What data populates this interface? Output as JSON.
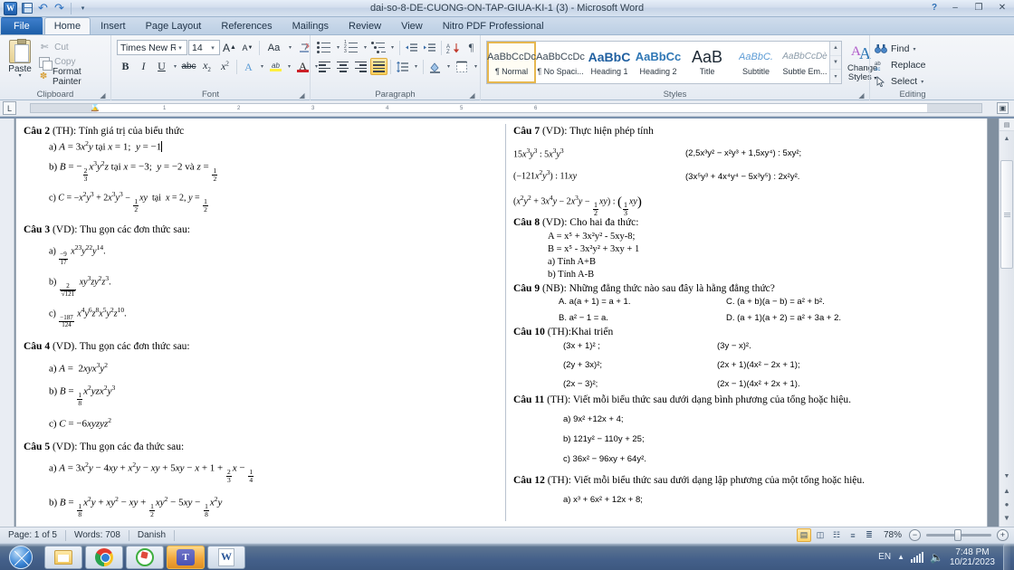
{
  "window": {
    "title": "dai-so-8-DE-CUONG-ON-TAP-GIUA-KI-1 (3)  -  Microsoft Word",
    "minimize": "–",
    "restore": "❐",
    "close": "✕",
    "help": "?"
  },
  "quick_access": {
    "word_letter": "W",
    "save": "save-icon",
    "undo": "↶",
    "redo": "↷",
    "customize": "▾"
  },
  "tabs": [
    {
      "label": "File",
      "id": "file"
    },
    {
      "label": "Home",
      "id": "home"
    },
    {
      "label": "Insert",
      "id": "insert"
    },
    {
      "label": "Page Layout",
      "id": "page-layout"
    },
    {
      "label": "References",
      "id": "references"
    },
    {
      "label": "Mailings",
      "id": "mailings"
    },
    {
      "label": "Review",
      "id": "review"
    },
    {
      "label": "View",
      "id": "view"
    },
    {
      "label": "Nitro PDF Professional",
      "id": "nitro-pdf"
    }
  ],
  "active_tab": "Home",
  "ribbon": {
    "clipboard": {
      "group_label": "Clipboard",
      "paste": "Paste",
      "cut": "Cut",
      "copy": "Copy",
      "format_painter": "Format Painter"
    },
    "font": {
      "group_label": "Font",
      "font_name": "Times New Rom",
      "font_size": "14",
      "grow_font": "A",
      "shrink_font": "A",
      "change_case": "Aa",
      "clear_formatting": "clear-formatting-icon",
      "bold": "B",
      "italic": "I",
      "underline": "U",
      "strikethrough": "abc",
      "subscript": "x",
      "superscript": "x",
      "text_effects": "A",
      "highlight": "ab",
      "font_color": "A"
    },
    "paragraph": {
      "group_label": "Paragraph",
      "bullets": "bullets-icon",
      "numbering": "numbering-icon",
      "multilevel": "multilevel-list-icon",
      "decrease_indent": "decrease-indent-icon",
      "increase_indent": "increase-indent-icon",
      "sort": "sort-icon",
      "show_marks": "¶",
      "align_left": "align-left-icon",
      "align_center": "align-center-icon",
      "align_right": "align-right-icon",
      "justify": "justify-icon",
      "line_spacing": "line-spacing-icon",
      "shading": "shading-icon",
      "borders": "borders-icon"
    },
    "styles": {
      "group_label": "Styles",
      "items": [
        {
          "preview": "AaBbCcDc",
          "name": "¶ Normal",
          "selected": true
        },
        {
          "preview": "AaBbCcDc",
          "name": "¶ No Spaci...",
          "selected": false
        },
        {
          "preview": "AaBbC",
          "name": "Heading 1",
          "selected": false
        },
        {
          "preview": "AaBbCc",
          "name": "Heading 2",
          "selected": false
        },
        {
          "preview": "AaB",
          "name": "Title",
          "selected": false
        },
        {
          "preview": "AaBbC.",
          "name": "Subtitle",
          "selected": false
        },
        {
          "preview": "AaBbCcDè",
          "name": "Subtle Em...",
          "selected": false
        }
      ],
      "change_styles": "Change\nStyles"
    },
    "editing": {
      "group_label": "Editing",
      "find": "Find",
      "replace": "Replace",
      "select": "Select"
    }
  },
  "ruler": {
    "tab_selector": "L",
    "marks": [
      "1",
      "2",
      "3",
      "4",
      "5",
      "6"
    ]
  },
  "document": {
    "left_column": [
      {
        "heading_bold": "Câu 2",
        "heading_rest": " (TH): Tính giá trị của biểu thức",
        "items": [
          {
            "label": "a)",
            "text": "A = 3x²y tại x = 1;  y = −1",
            "caret": true
          },
          {
            "label": "b)",
            "text": "B = −⅔x³y²z tại x = −3;  y = −2 và z = ½"
          },
          {
            "label": "c)",
            "text": "C = −x²y³ + 2x³y³ − ½xy  tại  x = 2, y = ½"
          }
        ]
      },
      {
        "heading_bold": "Câu 3",
        "heading_rest": " (VD): Thu gọn các đơn thức sau:",
        "items": [
          {
            "label": "a)",
            "text": "(−9/17) x²³y²²y¹⁴."
          },
          {
            "label": "b)",
            "text": "(2/√121) xy³zy²z³."
          },
          {
            "label": "c)",
            "text": "(−187/124) x⁴y⁶z⁸x⁵y²z¹⁰."
          }
        ]
      },
      {
        "heading_bold": "Câu 4",
        "heading_rest": " (VD). Thu gọn các đơn thức sau:",
        "items": [
          {
            "label": "a)",
            "text": "A =  2xyx³y²"
          },
          {
            "label": "b)",
            "text": "B = ⅛x²yzx²y³"
          },
          {
            "label": "c)",
            "text": "C = −6xyzyz²"
          }
        ]
      },
      {
        "heading_bold": "Câu 5",
        "heading_rest": " (VD): Thu gọn các đa thức sau:",
        "items": [
          {
            "label": "a)",
            "text": "A = 3x²y − 4xy + x²y − xy + 5xy − x + 1 + ⅔x − ¼"
          },
          {
            "label": "b)",
            "text": "B = ⅛x²y + xy² − xy + ½xy² − 5xy − ⅛x²y"
          }
        ]
      }
    ],
    "right_column": {
      "cau7": {
        "heading_bold": "Câu 7",
        "heading_rest": " (VD): Thực hiện phép tính",
        "left_lines": [
          "15x³y³ : 5x³y³",
          "(−121x²y³) : 11xy",
          "(x²y² + 3x⁴y − 2x³y − ½xy) : (⅓xy)"
        ],
        "right_lines": [
          "(2,5x³y² − x²y³ + 1,5xy⁴) : 5xy²;",
          "(3x⁵y³ + 4x⁴y⁴ − 5x³y⁵) : 2x²y²."
        ]
      },
      "cau8": {
        "heading_bold": "Câu 8",
        "heading_rest": " (VD): Cho hai đa thức:",
        "lines": [
          "A = x⁵ + 3x²y² - 5xy-8;",
          "B = x⁵ - 3x²y² + 3xy + 1",
          "a)  Tính A+B",
          "b)  Tính A-B"
        ]
      },
      "cau9": {
        "heading_bold": "Câu 9",
        "heading_rest": " (NB): Những đẳng thức nào sau đây là hằng đẳng thức?",
        "choices": [
          {
            "left": "A. a(a + 1) = a + 1.",
            "right": "C. (a + b)(a − b) = a² + b²."
          },
          {
            "left": "B. a² − 1 = a.",
            "right": "D. (a + 1)(a + 2) = a² + 3a + 2."
          }
        ]
      },
      "cau10": {
        "heading_bold": "Câu 10",
        "heading_rest": " (TH):Khai triển",
        "rows": [
          {
            "left": "(3x + 1)² ;",
            "right": "(3y − x)²."
          },
          {
            "left": "(2y + 3x)²;",
            "right": "(2x + 1)(4x² − 2x + 1);"
          },
          {
            "left": "(2x − 3)²;",
            "right": "(2x − 1)(4x² + 2x + 1)."
          }
        ]
      },
      "cau11": {
        "heading_bold": "Câu 11",
        "heading_rest": " (TH): Viết mỗi biểu thức sau dưới dạng bình phương của tổng hoặc hiệu.",
        "items": [
          "a) 9x² +12x + 4;",
          "b) 121y² − 110y + 25;",
          "c) 36x² − 96xy + 64y²."
        ]
      },
      "cau12": {
        "heading_bold": "Câu 12",
        "heading_rest": " (TH): Viết mỗi biểu thức sau dưới dạng lập phương của một tổng hoặc hiệu.",
        "items": [
          "a) x³ + 6x² + 12x + 8;"
        ]
      }
    }
  },
  "status_bar": {
    "page": "Page: 1 of 5",
    "words": "Words: 708",
    "language": "Danish",
    "view_buttons": [
      "print-layout",
      "full-screen-reading",
      "web-layout",
      "outline",
      "draft"
    ],
    "zoom": "78%",
    "zoom_out": "−",
    "zoom_in": "+"
  },
  "taskbar": {
    "start": "start-orb",
    "buttons": [
      {
        "name": "windows-explorer",
        "active": false
      },
      {
        "name": "google-chrome",
        "active": false
      },
      {
        "name": "green-app",
        "active": false
      },
      {
        "name": "microsoft-teams",
        "label": "T",
        "active": true
      },
      {
        "name": "microsoft-word",
        "label": "W",
        "active": false
      }
    ],
    "tray": {
      "language": "EN",
      "time": "7:48 PM",
      "date": "10/21/2023"
    }
  }
}
